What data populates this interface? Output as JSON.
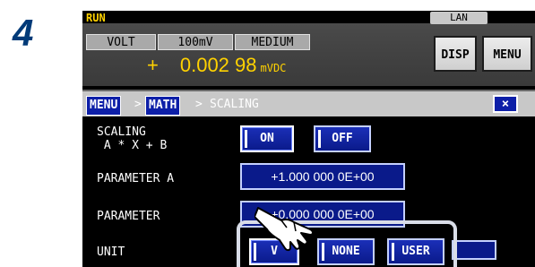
{
  "step": "4",
  "status": {
    "run": "RUN",
    "lan": "LAN"
  },
  "fields": {
    "function": "VOLT",
    "range": "100mV",
    "speed": "MEDIUM"
  },
  "buttons": {
    "disp": "DISP",
    "menu": "MENU"
  },
  "reading": {
    "sign": "+",
    "value": "0.002 98",
    "unit": "mVDC"
  },
  "breadcrumb": {
    "menu": "MENU",
    "math": "MATH",
    "sep": ">",
    "current": "SCALING",
    "close": "×"
  },
  "rows": {
    "scaling": {
      "label": "SCALING\n A * X + B",
      "on": "ON",
      "off": "OFF"
    },
    "param_a": {
      "label": "PARAMETER A",
      "value": "+1.000 000 0E+00"
    },
    "param_b": {
      "label": "PARAMETER",
      "value": "+0.000 000 0E+00"
    },
    "unit": {
      "label": "UNIT",
      "v": "V",
      "none": "NONE",
      "user": "USER"
    }
  },
  "colors": {
    "reading": "#ffd200",
    "button": "#0d1fa8",
    "step": "#003a78"
  },
  "icons": {
    "pointer": "pointing-hand-icon",
    "close": "close-icon"
  }
}
